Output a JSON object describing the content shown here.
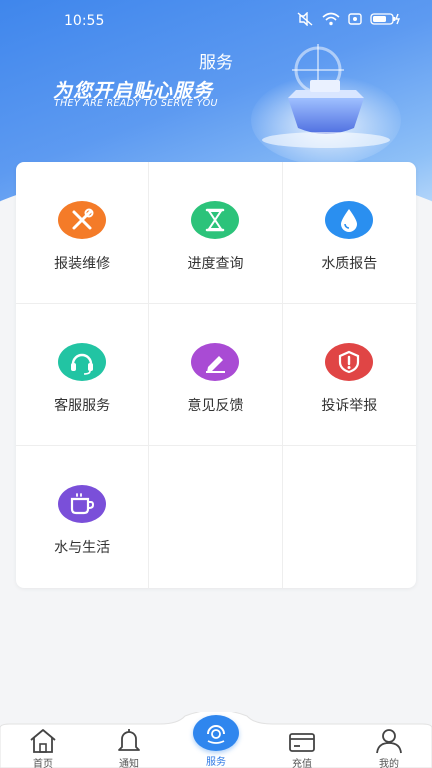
{
  "status": {
    "time": "10:55"
  },
  "header": {
    "title": "服务",
    "slogan": "为您开启贴心服务",
    "slogan_en": "THEY ARE READY TO SERVE YOU"
  },
  "services": [
    {
      "label": "报装维修",
      "icon": "tools-icon",
      "color": "#f47b28"
    },
    {
      "label": "进度查询",
      "icon": "hourglass-icon",
      "color": "#2cc37a"
    },
    {
      "label": "水质报告",
      "icon": "water-drop-icon",
      "color": "#2a8ff0"
    },
    {
      "label": "客服服务",
      "icon": "headset-icon",
      "color": "#22c4a3"
    },
    {
      "label": "意见反馈",
      "icon": "pencil-icon",
      "color": "#a94bd4"
    },
    {
      "label": "投诉举报",
      "icon": "warning-shield-icon",
      "color": "#e04545"
    },
    {
      "label": "水与生活",
      "icon": "cup-icon",
      "color": "#7a4fd9"
    }
  ],
  "tabbar": {
    "items": [
      {
        "label": "首页",
        "icon": "home-icon"
      },
      {
        "label": "通知",
        "icon": "bell-icon"
      },
      {
        "label": "服务",
        "icon": "service-icon"
      },
      {
        "label": "充值",
        "icon": "wallet-icon"
      },
      {
        "label": "我的",
        "icon": "user-icon"
      }
    ],
    "active_color": "#2f7ae5"
  }
}
